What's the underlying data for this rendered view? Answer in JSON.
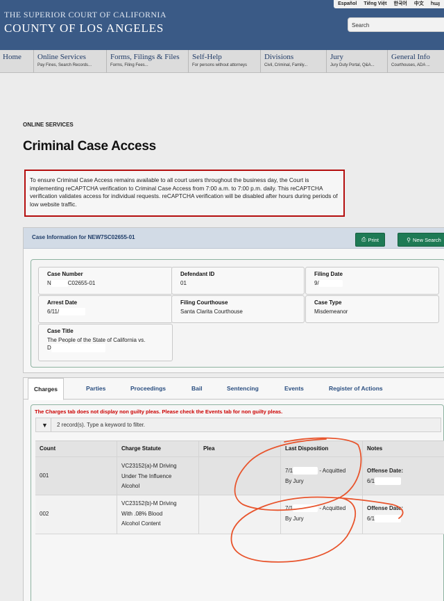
{
  "header": {
    "languages": [
      "Español",
      "Tiếng Việt",
      "한국어",
      "中文",
      "հայ"
    ],
    "court_name": "THE SUPERIOR COURT OF CALIFORNIA",
    "county_name": "COUNTY OF LOS ANGELES",
    "search_placeholder": "Search"
  },
  "nav": [
    {
      "title": "Home",
      "sub": ""
    },
    {
      "title": "Online Services",
      "sub": "Pay Fines, Search Records..."
    },
    {
      "title": "Forms, Filings & Files",
      "sub": "Forms, Filing Fees..."
    },
    {
      "title": "Self-Help",
      "sub": "For persons without attorneys"
    },
    {
      "title": "Divisions",
      "sub": "Civil, Criminal, Family..."
    },
    {
      "title": "Jury",
      "sub": "Jury Duty Portal, Q&A..."
    },
    {
      "title": "General Info",
      "sub": "Courthouses, ADA ..."
    }
  ],
  "page": {
    "section": "ONLINE SERVICES",
    "title": "Criminal Case Access",
    "notice": "To ensure Criminal Case Access remains available to all court users throughout the business day, the Court is implementing reCAPTCHA verification to Criminal Case Access from 7:00 a.m. to 7:00 p.m. daily. This reCAPTCHA verification validates access for individual requests. reCAPTCHA verification will be disabled after hours during periods of low website traffic."
  },
  "case": {
    "header_title": "Case Information for NEW7SC02655-01",
    "print_label": "Print",
    "new_search_label": "New Search",
    "fields": {
      "case_number": {
        "label": "Case Number",
        "value_prefix": "N",
        "value_suffix": "C02655-01"
      },
      "defendant_id": {
        "label": "Defendant ID",
        "value": "01"
      },
      "filing_date": {
        "label": "Filing Date",
        "value_prefix": "9/"
      },
      "arrest_date": {
        "label": "Arrest Date",
        "value_prefix": "6/11/"
      },
      "filing_courthouse": {
        "label": "Filing Courthouse",
        "value": "Santa Clarita Courthouse"
      },
      "case_type": {
        "label": "Case Type",
        "value": "Misdemeanor"
      },
      "case_title": {
        "label": "Case Title",
        "value_line1": "The People of the State of California vs.",
        "value_line2_prefix": "D"
      }
    }
  },
  "tabs": [
    "Charges",
    "Parties",
    "Proceedings",
    "Bail",
    "Sentencing",
    "Events",
    "Register of Actions"
  ],
  "charges": {
    "warning": "The Charges tab does not display non guilty pleas. Please check the Events tab for non guilty pleas.",
    "filter_text": "2 record(s). Type a keyword to filter.",
    "columns": [
      "Count",
      "Charge Statute",
      "Plea",
      "Last Disposition",
      "Notes"
    ],
    "rows": [
      {
        "count": "001",
        "statute_lines": [
          "VC23152(a)-M Driving",
          "Under The Influence",
          "Alcohol"
        ],
        "plea": "",
        "disposition_prefix": "7/1",
        "disposition_suffix": "- Acquitted",
        "disposition_line2": "By Jury",
        "notes_label": "Offense Date:",
        "notes_value_prefix": "6/1"
      },
      {
        "count": "002",
        "statute_lines": [
          "VC23152(b)-M Driving",
          "With .08% Blood",
          "Alcohol Content"
        ],
        "plea": "",
        "disposition_prefix": "7/1",
        "disposition_suffix": "- Acquitted",
        "disposition_line2": "By Jury",
        "notes_label": "Offense Date:",
        "notes_value_prefix": "6/1"
      }
    ]
  },
  "colors": {
    "header_bg": "#3a5a86",
    "notice_border": "#b40d0d",
    "button_green": "#1e7a55",
    "warning_red": "#cc0000",
    "annotation_orange": "#e8542c"
  },
  "icons": {
    "print": "print-icon",
    "search": "search-icon",
    "filter": "filter-icon"
  }
}
